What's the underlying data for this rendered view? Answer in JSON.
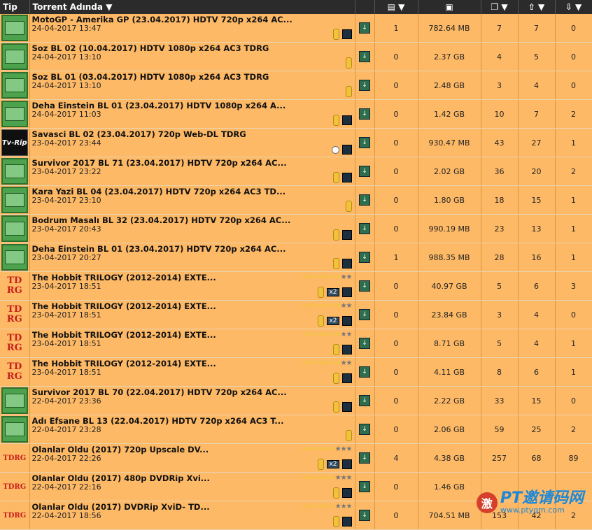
{
  "header": {
    "tip": "Tip",
    "name": "Torrent Adında",
    "sort_glyph": "▼",
    "col_icons": [
      "comments-icon",
      "size-icon",
      "files-icon",
      "seeders-icon",
      "leechers-icon"
    ]
  },
  "rows": [
    {
      "cat": "tv",
      "name": "MotoGP - Amerika GP (23.04.2017) HDTV 720p x264 AC...",
      "date": "24-04-2017 13:47",
      "comments": "1",
      "size": "782.64 MB",
      "files": "7",
      "seeders": "7",
      "leechers": "0",
      "gold": true,
      "box": true,
      "circle": false,
      "x2": false,
      "stars": 0
    },
    {
      "cat": "tv",
      "name": "Soz BL 02 (10.04.2017) HDTV 1080p x264 AC3 TDRG",
      "date": "24-04-2017 13:10",
      "comments": "0",
      "size": "2.37 GB",
      "files": "4",
      "seeders": "5",
      "leechers": "0",
      "gold": true,
      "box": false,
      "circle": false,
      "x2": false,
      "stars": 0
    },
    {
      "cat": "tv",
      "name": "Soz BL 01 (03.04.2017) HDTV 1080p x264 AC3 TDRG",
      "date": "24-04-2017 13:10",
      "comments": "0",
      "size": "2.48 GB",
      "files": "3",
      "seeders": "4",
      "leechers": "0",
      "gold": true,
      "box": false,
      "circle": false,
      "x2": false,
      "stars": 0
    },
    {
      "cat": "tv",
      "name": "Deha Einstein BL 01 (23.04.2017) HDTV 1080p x264 A...",
      "date": "24-04-2017 11:03",
      "comments": "0",
      "size": "1.42 GB",
      "files": "10",
      "seeders": "7",
      "leechers": "2",
      "gold": true,
      "box": true,
      "circle": false,
      "x2": false,
      "stars": 0
    },
    {
      "cat": "rip",
      "name": "Savasci BL 02 (23.04.2017) 720p Web-DL TDRG",
      "date": "23-04-2017 23:44",
      "comments": "0",
      "size": "930.47 MB",
      "files": "43",
      "seeders": "27",
      "leechers": "1",
      "gold": false,
      "box": true,
      "circle": true,
      "x2": false,
      "stars": 0
    },
    {
      "cat": "tv",
      "name": "Survivor 2017 BL 71 (23.04.2017) HDTV 720p x264 AC...",
      "date": "23-04-2017 23:22",
      "comments": "0",
      "size": "2.02 GB",
      "files": "36",
      "seeders": "20",
      "leechers": "2",
      "gold": true,
      "box": true,
      "circle": false,
      "x2": false,
      "stars": 0
    },
    {
      "cat": "tv",
      "name": "Kara Yazi BL 04 (23.04.2017) HDTV 720p x264 AC3 TD...",
      "date": "23-04-2017 23:10",
      "comments": "0",
      "size": "1.80 GB",
      "files": "18",
      "seeders": "15",
      "leechers": "1",
      "gold": true,
      "box": false,
      "circle": false,
      "x2": false,
      "stars": 0
    },
    {
      "cat": "tv",
      "name": "Bodrum Masalı BL 32 (23.04.2017) HDTV 720p x264 AC...",
      "date": "23-04-2017 20:43",
      "comments": "0",
      "size": "990.19 MB",
      "files": "23",
      "seeders": "13",
      "leechers": "1",
      "gold": true,
      "box": true,
      "circle": false,
      "x2": false,
      "stars": 0
    },
    {
      "cat": "tv",
      "name": "Deha Einstein BL 01 (23.04.2017) HDTV 720p x264 AC...",
      "date": "23-04-2017 20:27",
      "comments": "1",
      "size": "988.35 MB",
      "files": "28",
      "seeders": "16",
      "leechers": "1",
      "gold": true,
      "box": true,
      "circle": false,
      "x2": false,
      "stars": 0
    },
    {
      "cat": "tdrg",
      "name": "The Hobbit TRILOGY (2012-2014) EXTE...",
      "date": "23-04-2017 18:51",
      "comments": "0",
      "size": "40.97 GB",
      "files": "5",
      "seeders": "6",
      "leechers": "3",
      "gold": true,
      "box": true,
      "circle": false,
      "x2": true,
      "stars": 7
    },
    {
      "cat": "tdrg",
      "name": "The Hobbit TRILOGY (2012-2014) EXTE...",
      "date": "23-04-2017 18:51",
      "comments": "0",
      "size": "23.84 GB",
      "files": "3",
      "seeders": "4",
      "leechers": "0",
      "gold": true,
      "box": true,
      "circle": false,
      "x2": true,
      "stars": 7
    },
    {
      "cat": "tdrg",
      "name": "The Hobbit TRILOGY (2012-2014) EXTE...",
      "date": "23-04-2017 18:51",
      "comments": "0",
      "size": "8.71 GB",
      "files": "5",
      "seeders": "4",
      "leechers": "1",
      "gold": true,
      "box": true,
      "circle": false,
      "x2": false,
      "stars": 7
    },
    {
      "cat": "tdrg",
      "name": "The Hobbit TRILOGY (2012-2014) EXTE...",
      "date": "23-04-2017 18:51",
      "comments": "0",
      "size": "4.11 GB",
      "files": "8",
      "seeders": "6",
      "leechers": "1",
      "gold": true,
      "box": true,
      "circle": false,
      "x2": false,
      "stars": 7
    },
    {
      "cat": "tv",
      "name": "Survivor 2017 BL 70 (22.04.2017) HDTV 720p x264 AC...",
      "date": "22-04-2017 23:36",
      "comments": "0",
      "size": "2.22 GB",
      "files": "33",
      "seeders": "15",
      "leechers": "0",
      "gold": true,
      "box": true,
      "circle": false,
      "x2": false,
      "stars": 0
    },
    {
      "cat": "tv",
      "name": "Adı Efsane BL 13 (22.04.2017) HDTV 720p x264 AC3 T...",
      "date": "22-04-2017 23:28",
      "comments": "0",
      "size": "2.06 GB",
      "files": "59",
      "seeders": "25",
      "leechers": "2",
      "gold": true,
      "box": false,
      "circle": false,
      "x2": false,
      "stars": 0
    },
    {
      "cat": "tdrg2",
      "name": "Olanlar Oldu (2017) 720p Upscale DV...",
      "date": "22-04-2017 22:26",
      "comments": "4",
      "size": "4.38 GB",
      "files": "257",
      "seeders": "68",
      "leechers": "89",
      "gold": true,
      "box": true,
      "circle": false,
      "x2": true,
      "stars": 6
    },
    {
      "cat": "tdrg2",
      "name": "Olanlar Oldu (2017) 480p DVDRip Xvi...",
      "date": "22-04-2017 22:16",
      "comments": "0",
      "size": "1.46 GB",
      "files": "",
      "seeders": "",
      "leechers": "",
      "gold": true,
      "box": true,
      "circle": false,
      "x2": false,
      "stars": 6
    },
    {
      "cat": "tdrg2",
      "name": "Olanlar Oldu (2017) DVDRip XviD- TD...",
      "date": "22-04-2017 18:56",
      "comments": "0",
      "size": "704.51 MB",
      "files": "153",
      "seeders": "42",
      "leechers": "2",
      "gold": true,
      "box": true,
      "circle": false,
      "x2": false,
      "stars": 6
    }
  ],
  "watermark": {
    "logo": "激",
    "main": "PT邀请码网",
    "sub": "www.ptyqm.com"
  },
  "labels": {
    "tv": "TV",
    "rip": "Tv-Rip",
    "tdrg": "TD\nRG",
    "tdrg2": "TDRG",
    "x2": "x2",
    "star_on": "★",
    "star_off": "★",
    "dl": "↓"
  }
}
